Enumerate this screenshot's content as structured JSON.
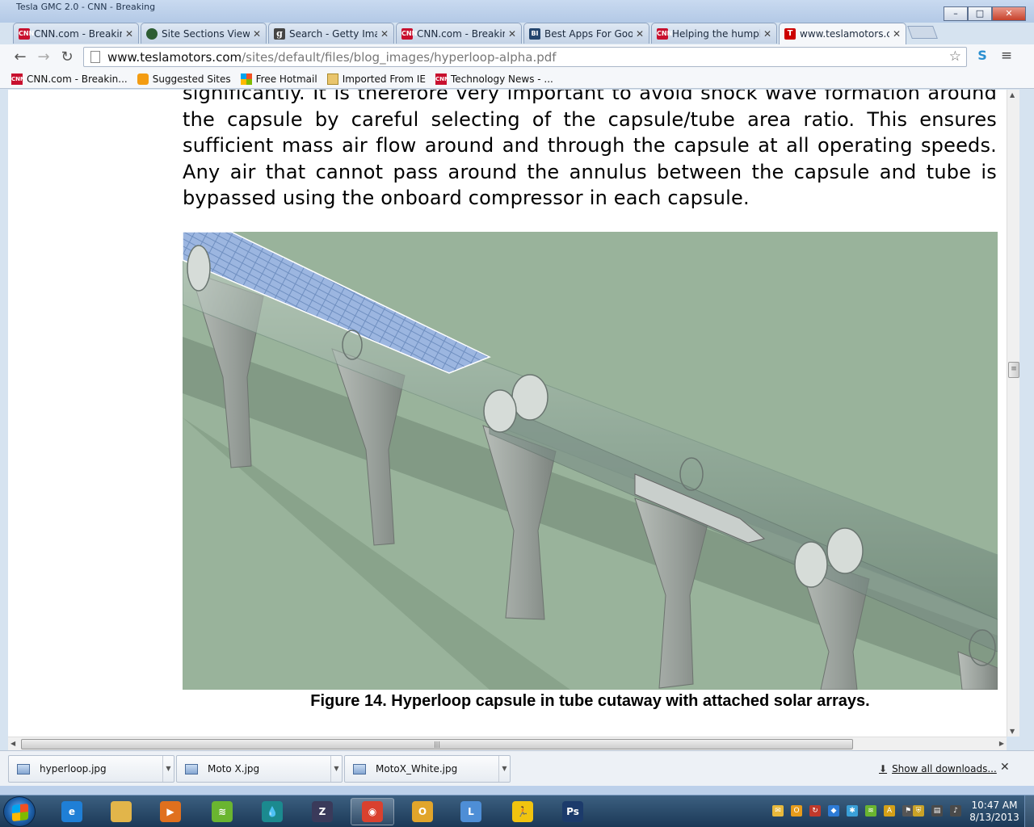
{
  "window": {
    "background_title": "Tesla GMC 2.0 - CNN - Breaking",
    "controls": {
      "minimize": "–",
      "maximize": "□",
      "close": "✕"
    }
  },
  "tabs": [
    {
      "label": "CNN.com - Breaking",
      "favicon": "cnn-icon",
      "favtext": "CNN"
    },
    {
      "label": "Site Sections Views",
      "favicon": "site-icon",
      "favtext": ""
    },
    {
      "label": "Search - Getty Imag",
      "favicon": "g-icon",
      "favtext": "g"
    },
    {
      "label": "CNN.com - Breaking",
      "favicon": "cnn-icon",
      "favtext": "CNN"
    },
    {
      "label": "Best Apps For Goog",
      "favicon": "bi-icon",
      "favtext": "BI"
    },
    {
      "label": "Helping the humpb",
      "favicon": "cnn-icon",
      "favtext": "CNN"
    },
    {
      "label": "www.teslamotors.c",
      "favicon": "tesla-icon",
      "favtext": "T",
      "active": true
    }
  ],
  "toolbar": {
    "back": "←",
    "forward": "→",
    "reload": "↻",
    "url_host": "www.teslamotors.com",
    "url_path": "/sites/default/files/blog_images/hyperloop-alpha.pdf",
    "star": "☆",
    "menu": "≡",
    "ext": "S"
  },
  "bookmarks": [
    {
      "label": "CNN.com - Breakin...",
      "icon": "cnn-icon"
    },
    {
      "label": "Suggested Sites",
      "icon": "suggested-sites-icon"
    },
    {
      "label": "Free Hotmail",
      "icon": "windows-icon"
    },
    {
      "label": "Imported From IE",
      "icon": "folder-icon"
    },
    {
      "label": "Technology News - ...",
      "icon": "cnn-icon"
    }
  ],
  "document": {
    "paragraph": "significantly. It is therefore very important to avoid shock wave formation around the capsule by careful selecting of the capsule/tube area ratio. This ensures sufficient mass air flow around and through the capsule at all operating speeds. Any air that cannot pass around the annulus between the capsule and tube is bypassed using the onboard compressor in each capsule.",
    "caption": "Figure 14. Hyperloop capsule in tube cutaway with attached solar arrays."
  },
  "scrollbars": {
    "vertical_grip": "≡",
    "horizontal_grip": "|||"
  },
  "downloads": {
    "items": [
      "hyperloop.jpg",
      "Moto X.jpg",
      "MotoX_White.jpg"
    ],
    "show_all": "Show all downloads...",
    "close": "✕"
  },
  "taskbar": {
    "apps": [
      {
        "name": "ie-icon",
        "text": "e",
        "color": "#1f7fd6"
      },
      {
        "name": "explorer-icon",
        "text": "",
        "color": "#e2b54a"
      },
      {
        "name": "media-player-icon",
        "text": "▶",
        "color": "#e0701e"
      },
      {
        "name": "spotify-icon",
        "text": "≋",
        "color": "#6ab530"
      },
      {
        "name": "drop-app-icon",
        "text": "💧",
        "color": "#1b8a8f"
      },
      {
        "name": "z-app-icon",
        "text": "Z",
        "color": "#3a3a5a"
      },
      {
        "name": "chrome-icon",
        "text": "◉",
        "color": "#d9412f"
      },
      {
        "name": "outlook-icon",
        "text": "O",
        "color": "#e1a52b"
      },
      {
        "name": "lync-icon",
        "text": "L",
        "color": "#4e8ed6"
      },
      {
        "name": "aim-icon",
        "text": "🏃",
        "color": "#f1c40f"
      },
      {
        "name": "photoshop-icon",
        "text": "Ps",
        "color": "#1c3b6b"
      }
    ],
    "clock_time": "10:47 AM",
    "clock_date": "8/13/2013"
  }
}
